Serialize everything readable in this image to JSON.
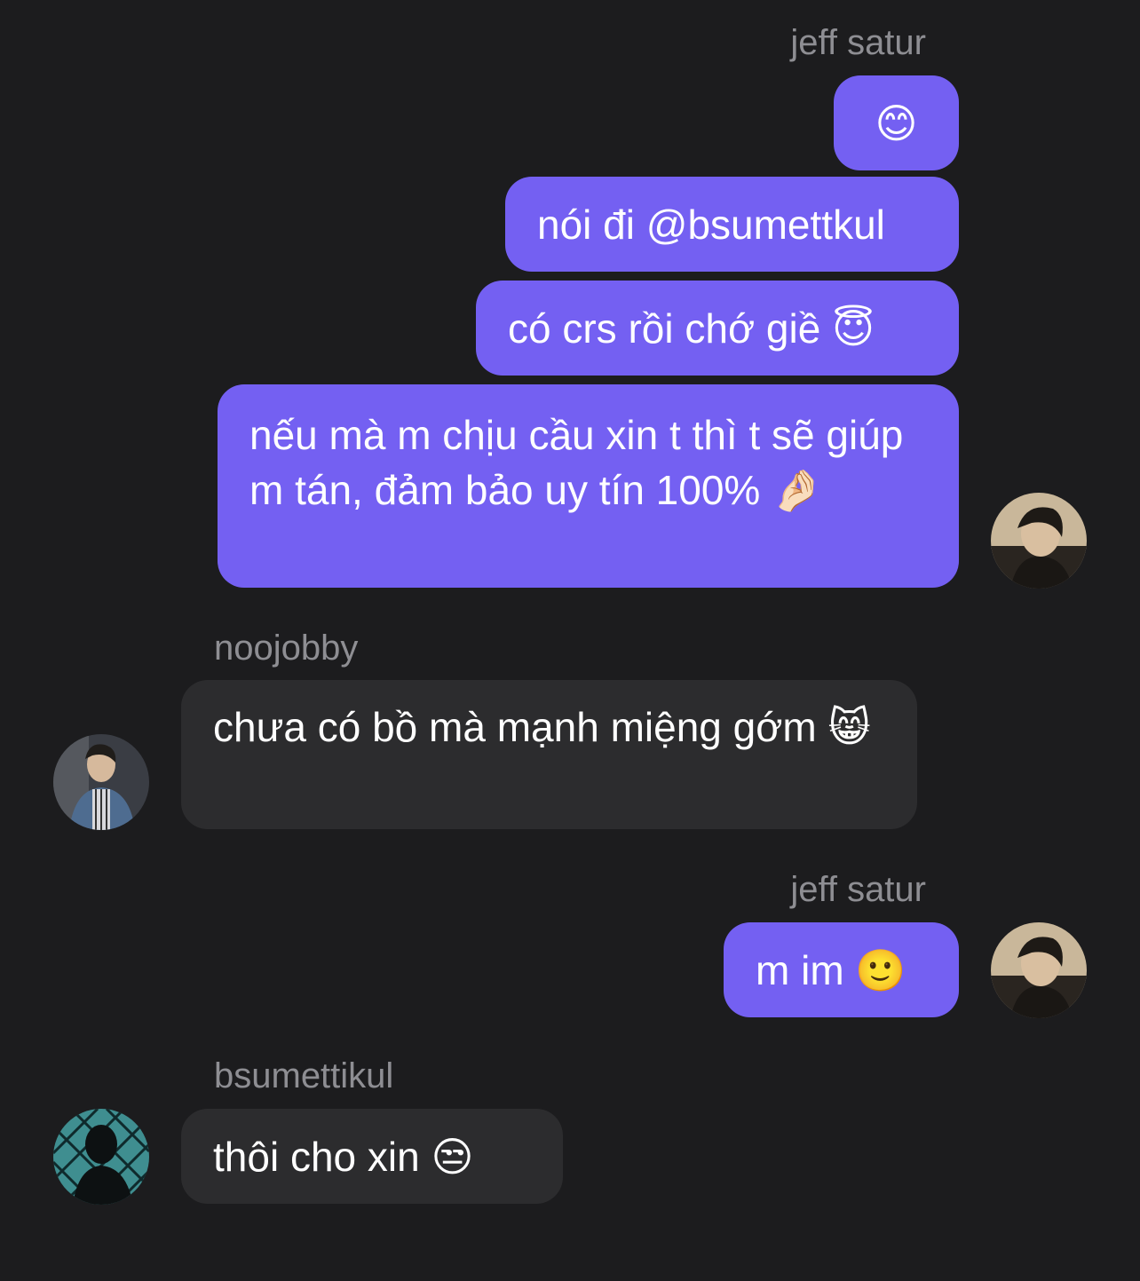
{
  "messages": [
    {
      "sender": "jeff satur"
    },
    {
      "text": "😊"
    },
    {
      "text": "nói đi @bsumettkul"
    },
    {
      "text": "có crs rồi chớ giề 😇"
    },
    {
      "text": "nếu mà m chịu cầu xin t thì t sẽ giúp m tán, đảm bảo uy tín 100% 🤌🏻"
    },
    {
      "sender": "noojobby",
      "text": "chưa có bồ mà mạnh miệng gớm 😸"
    },
    {
      "sender": "jeff satur",
      "text": "m im 🙂"
    },
    {
      "sender": "bsumettikul",
      "text": "thôi cho xin 😒"
    }
  ],
  "colors": {
    "outgoing_bubble": "#7460f2",
    "incoming_bubble": "#2c2c2e",
    "background": "#1c1c1e"
  }
}
